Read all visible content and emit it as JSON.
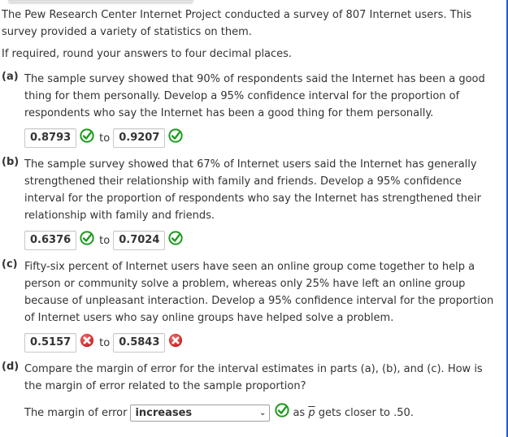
{
  "intro": {
    "line1": "The Pew Research Center Internet Project conducted a survey of 807 Internet users. This survey provided a variety of statistics on them.",
    "line2": "If required, round your answers to four decimal places."
  },
  "questions": [
    {
      "label": "(a)",
      "text": "The sample survey showed that 90% of respondents said the Internet has been a good thing for them personally. Develop a 95% confidence interval for the proportion of respondents who say the Internet has been a good thing for them personally.",
      "lower": "0.8793",
      "lower_status": "correct",
      "upper": "0.9207",
      "upper_status": "correct"
    },
    {
      "label": "(b)",
      "text": "The sample survey showed that 67% of Internet users said the Internet has generally strengthened their relationship with family and friends. Develop a 95% confidence interval for the proportion of respondents who say the Internet has strengthened their relationship with family and friends.",
      "lower": "0.6376",
      "lower_status": "correct",
      "upper": "0.7024",
      "upper_status": "correct"
    },
    {
      "label": "(c)",
      "text": "Fifty-six percent of Internet users have seen an online group come together to help a person or community solve a problem, whereas only 25% have left an online group because of unpleasant interaction. Develop a 95% confidence interval for the proportion of Internet users who say online groups have helped solve a problem.",
      "lower": "0.5157",
      "lower_status": "incorrect",
      "upper": "0.5843",
      "upper_status": "incorrect"
    },
    {
      "label": "(d)",
      "text": "Compare the margin of error for the interval estimates in parts (a), (b), and (c). How is the margin of error related to the sample proportion?",
      "prefix": "The margin of error",
      "selected": "increases",
      "status": "correct",
      "suffix_pre": "as",
      "pbar": "p",
      "suffix_post": "gets closer to .50."
    }
  ],
  "interval_connector": "to",
  "colors": {
    "correct": "#1a9a1a",
    "incorrect": "#d42a2a",
    "accent_border": "#1e5fbf"
  }
}
